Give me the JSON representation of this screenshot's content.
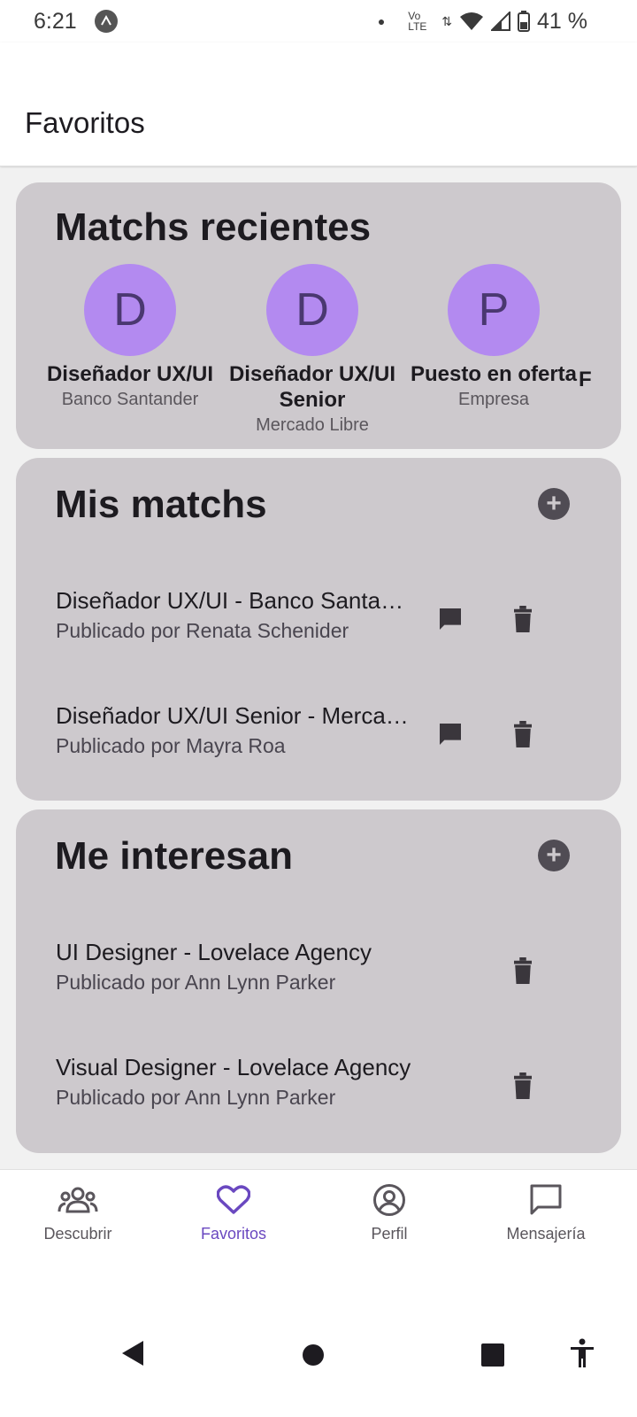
{
  "status_bar": {
    "time": "6:21",
    "network": "Vo LTE",
    "battery": "41 %",
    "icons": [
      "app-icon",
      "dot-icon",
      "volte-icon",
      "data-arrows-icon",
      "wifi-icon",
      "signal-icon",
      "battery-icon"
    ]
  },
  "app_bar": {
    "title": "Favoritos"
  },
  "recent_matches": {
    "title": "Matchs recientes",
    "items": [
      {
        "initial": "D",
        "title": "Diseñador UX/UI",
        "company": "Banco Santander"
      },
      {
        "initial": "D",
        "title": "Diseñador UX/UI Senior",
        "company": "Mercado Libre"
      },
      {
        "initial": "P",
        "title": "Puesto en oferta",
        "company": "Empresa"
      },
      {
        "initial": "",
        "title": "F",
        "company": ""
      }
    ]
  },
  "my_matches": {
    "title": "Mis matchs",
    "add_icon": "add-circle-icon",
    "items": [
      {
        "title": "Diseñador UX/UI - Banco Santa…",
        "subtitle": "Publicado por Renata Schenider"
      },
      {
        "title": "Diseñador UX/UI Senior - Merca…",
        "subtitle": "Publicado por Mayra Roa"
      }
    ]
  },
  "interests": {
    "title": "Me interesan",
    "add_icon": "add-circle-icon",
    "items": [
      {
        "title": "UI Designer - Lovelace Agency",
        "subtitle": "Publicado por Ann Lynn Parker"
      },
      {
        "title": "Visual Designer - Lovelace Agency",
        "subtitle": "Publicado por Ann Lynn Parker"
      }
    ]
  },
  "bottom_nav": {
    "items": [
      {
        "label": "Descubrir",
        "icon": "group-icon"
      },
      {
        "label": "Favoritos",
        "icon": "heart-icon",
        "active": true
      },
      {
        "label": "Perfil",
        "icon": "account-circle-icon"
      },
      {
        "label": "Mensajería",
        "icon": "message-icon"
      }
    ]
  },
  "colors": {
    "accent": "#6a48c0",
    "avatar_bg": "#b38af0",
    "card_bg": "#cdc9cd",
    "page_bg": "#f1f1f1"
  }
}
